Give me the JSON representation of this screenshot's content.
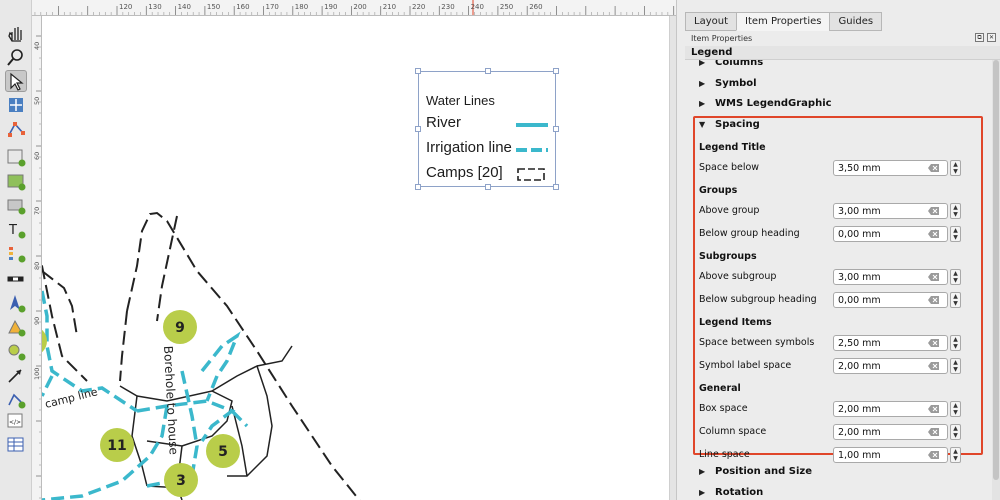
{
  "tabs": [
    {
      "label": "Layout",
      "active": false
    },
    {
      "label": "Item Properties",
      "active": true
    },
    {
      "label": "Guides",
      "active": false
    }
  ],
  "dock": {
    "title": "Item Properties",
    "panel_title": "Legend"
  },
  "groups_top": [
    {
      "label": "Columns",
      "state": "collapsed"
    },
    {
      "label": "Symbol",
      "state": "collapsed"
    },
    {
      "label": "WMS LegendGraphic",
      "state": "collapsed"
    }
  ],
  "spacing": {
    "label": "Spacing",
    "state": "expanded",
    "highlight_color": "#e0462a",
    "sections": [
      {
        "heading": "Legend Title",
        "rows": [
          {
            "label": "Space below",
            "value": "3,50 mm"
          }
        ]
      },
      {
        "heading": "Groups",
        "rows": [
          {
            "label": "Above group",
            "value": "3,00 mm"
          },
          {
            "label": "Below group heading",
            "value": "0,00 mm"
          }
        ]
      },
      {
        "heading": "Subgroups",
        "rows": [
          {
            "label": "Above subgroup",
            "value": "3,00 mm"
          },
          {
            "label": "Below subgroup heading",
            "value": "0,00 mm"
          }
        ]
      },
      {
        "heading": "Legend Items",
        "rows": [
          {
            "label": "Space between symbols",
            "value": "2,50 mm"
          },
          {
            "label": "Symbol label space",
            "value": "2,00 mm"
          }
        ]
      },
      {
        "heading": "General",
        "rows": [
          {
            "label": "Box space",
            "value": "2,00 mm"
          },
          {
            "label": "Column space",
            "value": "2,00 mm"
          },
          {
            "label": "Line space",
            "value": "1,00 mm"
          }
        ]
      }
    ]
  },
  "groups_bottom": [
    {
      "label": "Position and Size",
      "state": "collapsed"
    },
    {
      "label": "Rotation",
      "state": "collapsed"
    }
  ],
  "legend": {
    "title": "Water Lines",
    "items": [
      {
        "label": "River",
        "symbol": "solid-line"
      },
      {
        "label": "Irrigation line",
        "symbol": "dashed-line"
      },
      {
        "label": "Camps [20]",
        "symbol": "dashed-box"
      }
    ],
    "water_color": "#3bb8cc"
  },
  "map": {
    "markers": [
      {
        "label": "9"
      },
      {
        "label": "11"
      },
      {
        "label": "5"
      },
      {
        "label": "3"
      }
    ],
    "line_labels": [
      {
        "label": "Borehole to house"
      },
      {
        "label": "camp line"
      }
    ],
    "marker_color": "#b9cd4a"
  },
  "ruler": {
    "top_labels": [
      "120",
      "130",
      "140",
      "150",
      "160",
      "170",
      "180",
      "190",
      "200",
      "210",
      "220",
      "230",
      "240",
      "250",
      "260"
    ],
    "left_labels": [
      "40",
      "50",
      "60",
      "70",
      "80",
      "90",
      "100"
    ]
  },
  "toolbar_icons": [
    "pan-icon",
    "zoom-icon",
    "select-icon",
    "move-content-icon",
    "edit-nodes-icon",
    "add-map-icon",
    "add-picture-icon",
    "add-3d-map-icon",
    "add-label-icon",
    "add-legend-icon",
    "add-scalebar-icon",
    "add-north-arrow-icon",
    "add-shape-icon",
    "add-marker-icon",
    "add-arrow-icon",
    "add-polyline-icon",
    "add-html-icon",
    "add-attribute-table-icon"
  ]
}
